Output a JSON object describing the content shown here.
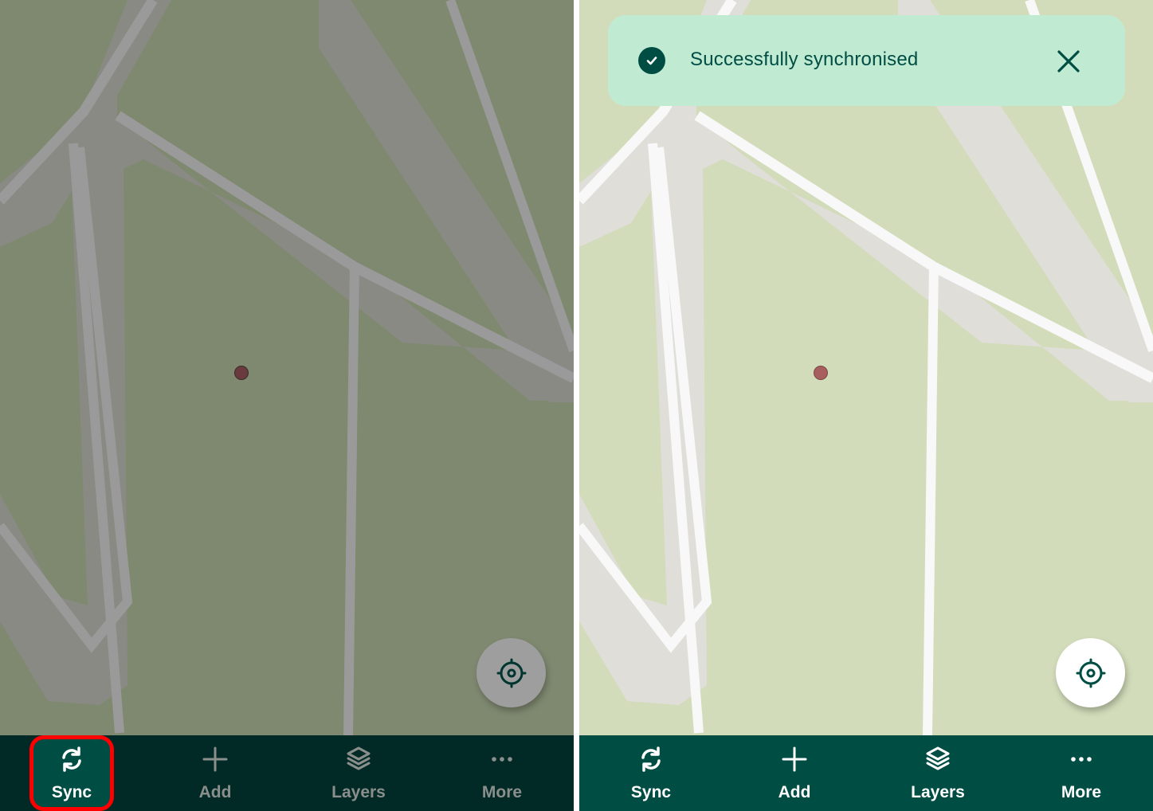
{
  "left_screen": {
    "state": "dimmed",
    "colors": {
      "map_background": "#7f8970",
      "road_casing": "#8a8a84",
      "road_fill": "#9a9a9a",
      "marker": "#6a3b3e",
      "navbar_background": "#012a26",
      "highlight_border": "#ff0000"
    },
    "nav": {
      "items": [
        {
          "label": "Sync",
          "icon": "sync-icon",
          "active": true
        },
        {
          "label": "Add",
          "icon": "plus-icon"
        },
        {
          "label": "Layers",
          "icon": "layers-icon"
        },
        {
          "label": "More",
          "icon": "more-horizontal-icon"
        }
      ]
    },
    "fab": {
      "icon": "gps-locate-icon"
    }
  },
  "right_screen": {
    "state": "normal",
    "colors": {
      "map_background": "#d2dcba",
      "road_casing": "#e0ded8",
      "road_fill": "#f8f8f8",
      "marker": "#a85d5e",
      "navbar_background": "#004d44",
      "toast_background": "#c0ebd2",
      "toast_text": "#004d44"
    },
    "toast": {
      "icon": "check-circle-icon",
      "message": "Successfully synchronised",
      "close_icon": "close-icon"
    },
    "nav": {
      "items": [
        {
          "label": "Sync",
          "icon": "sync-icon"
        },
        {
          "label": "Add",
          "icon": "plus-icon"
        },
        {
          "label": "Layers",
          "icon": "layers-icon"
        },
        {
          "label": "More",
          "icon": "more-horizontal-icon"
        }
      ]
    },
    "fab": {
      "icon": "gps-locate-icon"
    }
  }
}
